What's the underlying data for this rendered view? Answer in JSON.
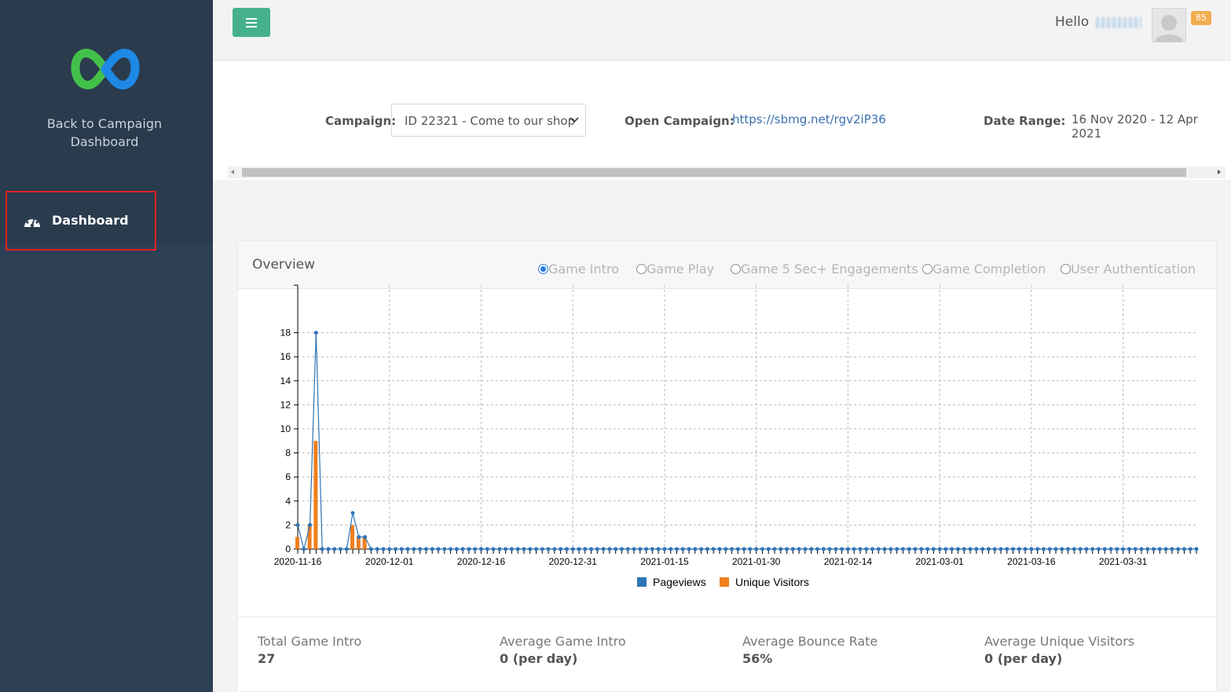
{
  "sidebar": {
    "back_link": "Back to Campaign Dashboard",
    "items": [
      {
        "label": "Dashboard",
        "icon": "dashboard-gauge-icon"
      }
    ],
    "brand_colors": {
      "logo_blue": "#1e88e5",
      "logo_green": "#43c04a",
      "background": "#2e4055"
    }
  },
  "header": {
    "menu_icon": "hamburger-menu-icon",
    "greeting": "Hello",
    "notification_count": "85",
    "accent_color": "#45b08c"
  },
  "filters": {
    "campaign_label": "Campaign:",
    "campaign_value": "ID 22321 - Come to our shop",
    "open_campaign_label": "Open Campaign:",
    "open_campaign_url": "https://sbmg.net/rgv2iP36",
    "date_range_label": "Date Range:",
    "date_range_value": "16 Nov 2020 - 12 Apr 2021"
  },
  "overview": {
    "title": "Overview",
    "options": [
      {
        "label": "Game Intro",
        "selected": true
      },
      {
        "label": "Game Play",
        "selected": false
      },
      {
        "label": "Game 5 Sec+ Engagements",
        "selected": false
      },
      {
        "label": "Game Completion",
        "selected": false
      },
      {
        "label": "User Authentication",
        "selected": false
      }
    ]
  },
  "chart_data": {
    "type": "bar",
    "start_date": "2020-11-16",
    "num_days": 148,
    "x_tick_labels": [
      "2020-11-16",
      "2020-12-01",
      "2020-12-16",
      "2020-12-31",
      "2021-01-15",
      "2021-01-30",
      "2021-02-14",
      "2021-03-01",
      "2021-03-16",
      "2021-03-31"
    ],
    "y_ticks": [
      0,
      2,
      4,
      6,
      8,
      10,
      12,
      14,
      16,
      18
    ],
    "ylim": [
      0,
      20
    ],
    "grid": true,
    "legend_position": "bottom",
    "series": [
      {
        "name": "Pageviews",
        "type": "line",
        "color": "#2f74b5",
        "values": [
          2,
          0,
          2,
          18,
          0,
          0,
          0,
          0,
          0,
          3,
          1,
          1,
          0
        ]
      },
      {
        "name": "Unique Visitors",
        "type": "bar",
        "color": "#f07f1e",
        "values": [
          1,
          0,
          2,
          9,
          0,
          0,
          0,
          0,
          0,
          2,
          1,
          1,
          0
        ]
      }
    ]
  },
  "stats": [
    {
      "title": "Total Game Intro",
      "value": "27"
    },
    {
      "title": "Average Game Intro",
      "value": "0 (per day)"
    },
    {
      "title": "Average Bounce Rate",
      "value": "56%"
    },
    {
      "title": "Average Unique Visitors",
      "value": "0 (per day)"
    }
  ]
}
